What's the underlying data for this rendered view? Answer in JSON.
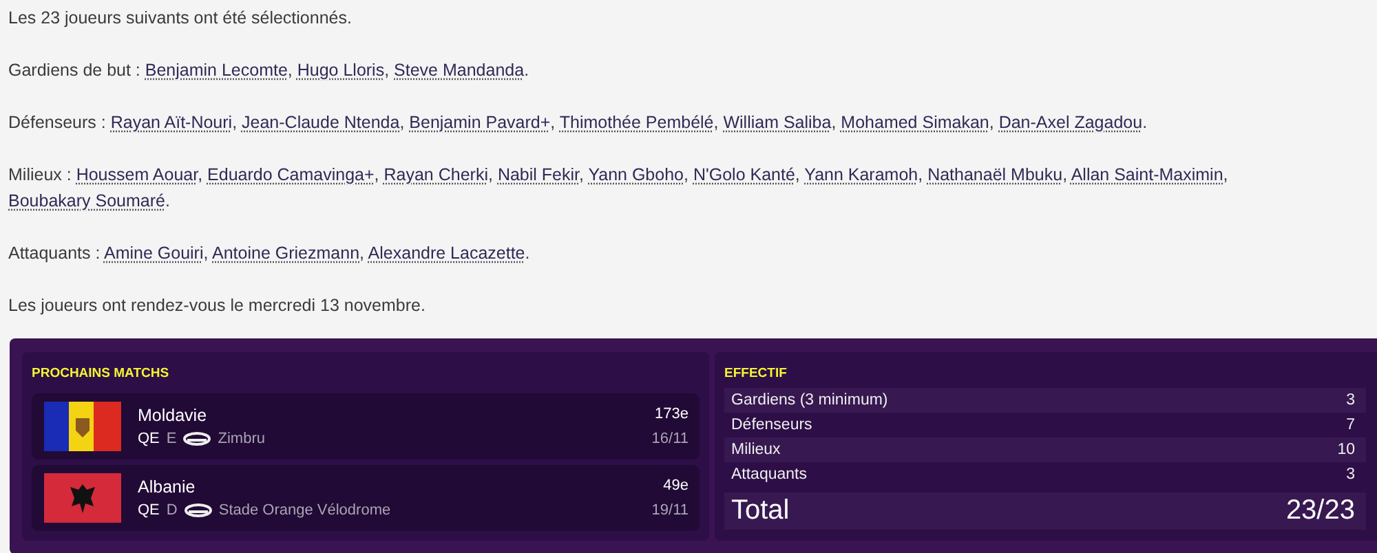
{
  "intro": "Les 23 joueurs suivants ont été sélectionnés.",
  "groups": [
    {
      "label": "Gardiens de but :",
      "players": [
        {
          "name": "Benjamin Lecomte",
          "after": ", "
        },
        {
          "name": "Hugo Lloris",
          "after": ", "
        },
        {
          "name": "Steve Mandanda",
          "after": "."
        }
      ]
    },
    {
      "label": "Défenseurs :",
      "players": [
        {
          "name": "Rayan Aït-Nouri",
          "after": ", "
        },
        {
          "name": "Jean-Claude Ntenda",
          "after": ", "
        },
        {
          "name": "Benjamin Pavard+",
          "after": ", "
        },
        {
          "name": "Thimothée Pembélé",
          "after": ", "
        },
        {
          "name": "William Saliba",
          "after": ", "
        },
        {
          "name": "Mohamed Simakan",
          "after": ", "
        },
        {
          "name": "Dan-Axel Zagadou",
          "after": "."
        }
      ]
    },
    {
      "label": "Milieux :",
      "players": [
        {
          "name": "Houssem Aouar",
          "after": ", "
        },
        {
          "name": "Eduardo Camavinga+",
          "after": ", "
        },
        {
          "name": "Rayan Cherki",
          "after": ", "
        },
        {
          "name": "Nabil Fekir",
          "after": ", "
        },
        {
          "name": "Yann Gboho",
          "after": ", "
        },
        {
          "name": "N'Golo Kanté",
          "after": ", "
        },
        {
          "name": "Yann Karamoh",
          "after": ", "
        },
        {
          "name": "Nathanaël Mbuku",
          "after": ", "
        },
        {
          "name": "Allan Saint-Maximin",
          "after": ", "
        },
        {
          "name": "Boubakary Soumaré",
          "after": "."
        }
      ]
    },
    {
      "label": "Attaquants :",
      "players": [
        {
          "name": "Amine Gouiri",
          "after": ", "
        },
        {
          "name": "Antoine Griezmann",
          "after": ", "
        },
        {
          "name": "Alexandre Lacazette",
          "after": "."
        }
      ]
    }
  ],
  "closing": "Les joueurs ont rendez-vous le mercredi 13 novembre.",
  "matches": {
    "title": "PROCHAINS MATCHS",
    "items": [
      {
        "kind": "moldova",
        "opponent": "Moldavie",
        "competition": "QE",
        "group": "E",
        "stadium": "Zimbru",
        "rank": "173e",
        "date": "16/11"
      },
      {
        "kind": "albania",
        "opponent": "Albanie",
        "competition": "QE",
        "group": "D",
        "stadium": "Stade Orange Vélodrome",
        "rank": "49e",
        "date": "19/11"
      }
    ]
  },
  "squad": {
    "title": "EFFECTIF",
    "rows": [
      {
        "label": "Gardiens (3 minimum)",
        "value": "3"
      },
      {
        "label": "Défenseurs",
        "value": "7"
      },
      {
        "label": "Milieux",
        "value": "10"
      },
      {
        "label": "Attaquants",
        "value": "3"
      }
    ],
    "total": {
      "label": "Total",
      "value": "23/23"
    }
  }
}
